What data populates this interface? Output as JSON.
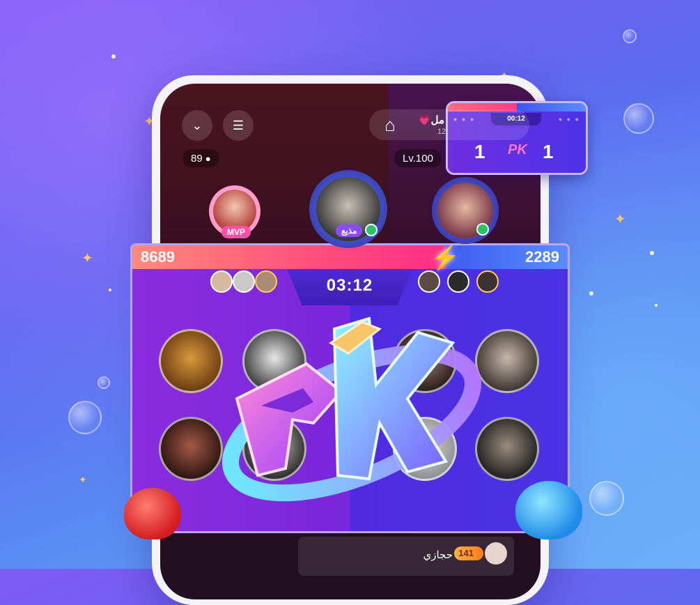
{
  "room": {
    "name": "مل💗",
    "room_id": "12",
    "online_count": "89",
    "level": "Lv.100"
  },
  "seats": {
    "mvp_label": "MVP",
    "host_label": "مذيع"
  },
  "pk": {
    "left_score": "8689",
    "right_score": "2289",
    "timer": "03:12"
  },
  "mini_pk": {
    "timer": "00:12",
    "left_score": "1",
    "right_score": "1",
    "logo": "PK"
  },
  "chat": {
    "username": "حجازي",
    "level": "141"
  },
  "icons": {
    "collapse": "chevron-down-icon",
    "menu": "menu-icon",
    "exit": "exit-room-icon",
    "user": "user-icon"
  },
  "colors": {
    "red_team": "#ff3b86",
    "blue_team": "#4b5cf0"
  }
}
